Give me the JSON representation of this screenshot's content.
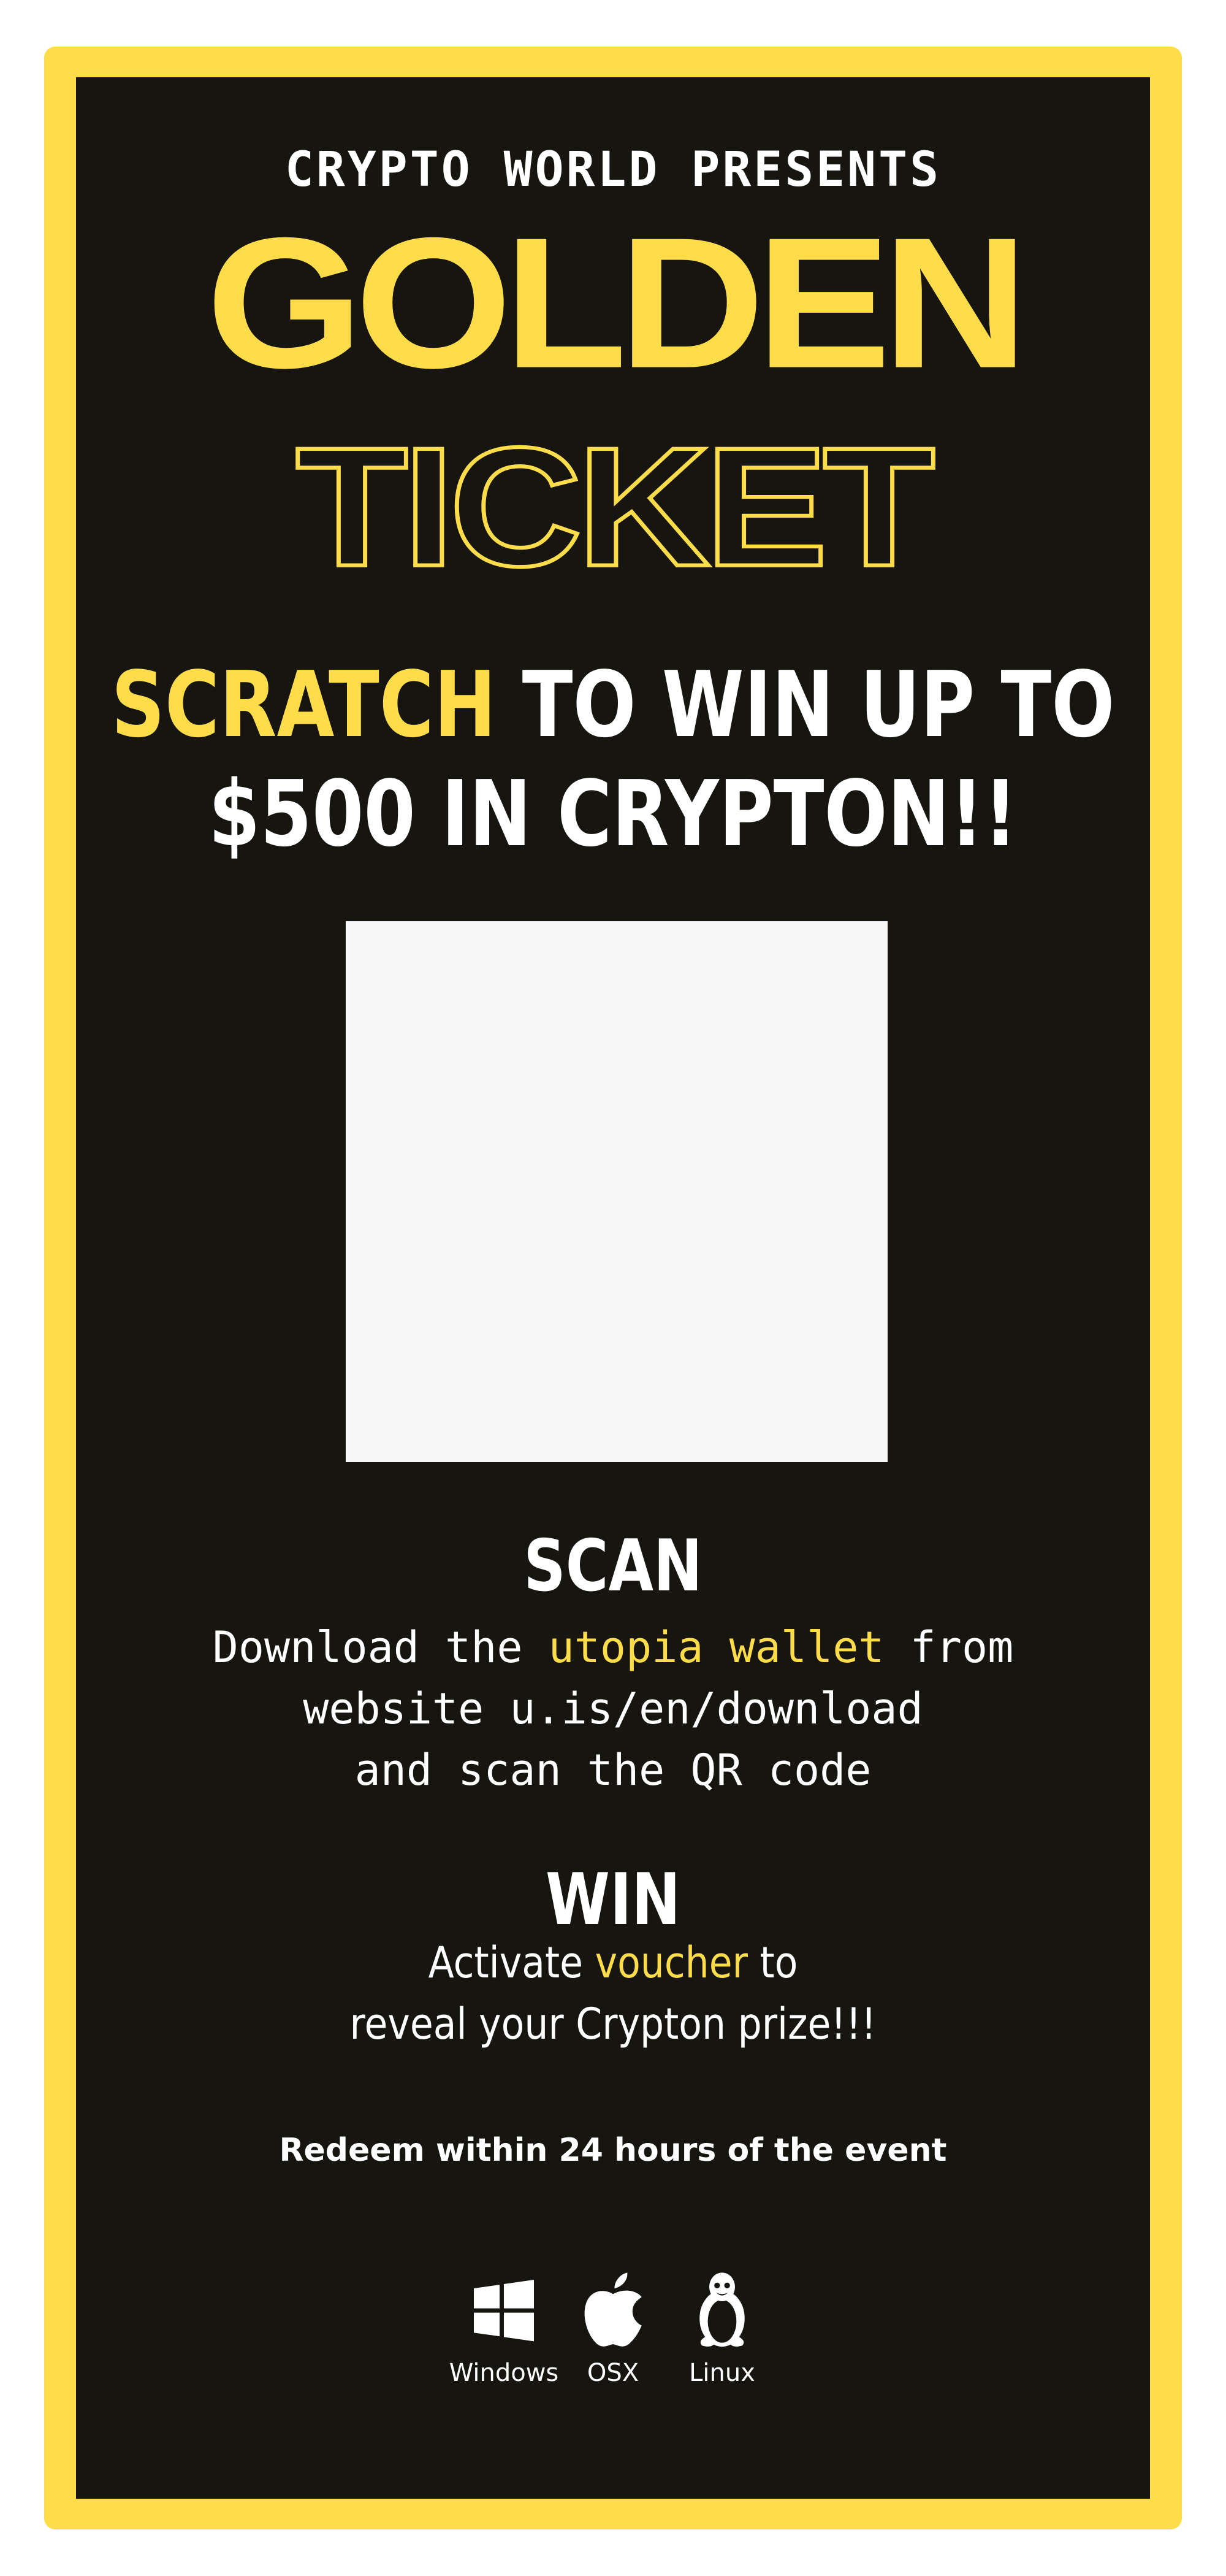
{
  "ticket": {
    "presenter": "CRYPTO WORLD PRESENTS",
    "title_line1": "GOLDEN",
    "title_line2": "TICKET",
    "headline": {
      "accent_word": "SCRATCH",
      "line1_rest": " TO WIN UP TO",
      "line2": "$500 IN CRYPTON!!"
    },
    "scan": {
      "title": "SCAN",
      "text_before": "Download the ",
      "highlight": "utopia wallet",
      "text_after": " from",
      "line2": "website u.is/en/download",
      "line3": "and scan the QR code"
    },
    "win": {
      "title": "WIN",
      "text_before": "Activate ",
      "highlight": "voucher",
      "text_after": " to",
      "line2": "reveal your Crypton prize!!!"
    },
    "redeem_note": "Redeem within 24 hours of the event",
    "platforms": [
      {
        "label": "Windows",
        "icon": "windows-icon"
      },
      {
        "label": "OSX",
        "icon": "apple-icon"
      },
      {
        "label": "Linux",
        "icon": "linux-penguin-icon"
      }
    ]
  },
  "colors": {
    "accent_yellow": "#FFDD4A",
    "background_dark": "#171510",
    "scratch_area": "#F7F7F7",
    "text_white": "#FFFFFF"
  }
}
